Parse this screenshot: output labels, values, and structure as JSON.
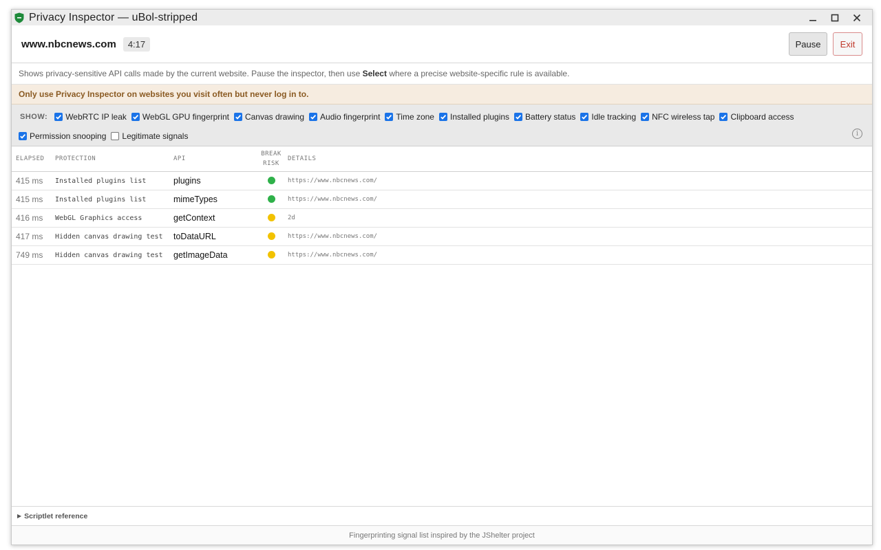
{
  "window": {
    "title": "Privacy Inspector — uBol-stripped"
  },
  "header": {
    "site": "www.nbcnews.com",
    "timer": "4:17",
    "pause_label": "Pause",
    "exit_label": "Exit"
  },
  "description": {
    "before": "Shows privacy-sensitive API calls made by the current website. Pause the inspector, then use ",
    "bold": "Select",
    "after": " where a precise website-specific rule is available."
  },
  "warning": "Only use Privacy Inspector on websites you visit often but never log in to.",
  "filters": {
    "show_label": "SHOW:",
    "items": [
      {
        "label": "WebRTC IP leak",
        "checked": true
      },
      {
        "label": "WebGL GPU fingerprint",
        "checked": true
      },
      {
        "label": "Canvas drawing",
        "checked": true
      },
      {
        "label": "Audio fingerprint",
        "checked": true
      },
      {
        "label": "Time zone",
        "checked": true
      },
      {
        "label": "Installed plugins",
        "checked": true
      },
      {
        "label": "Battery status",
        "checked": true
      },
      {
        "label": "Idle tracking",
        "checked": true
      },
      {
        "label": "NFC wireless tap",
        "checked": true
      },
      {
        "label": "Clipboard access",
        "checked": true
      },
      {
        "label": "Permission snooping",
        "checked": true
      },
      {
        "label": "Legitimate signals",
        "checked": false
      }
    ]
  },
  "table": {
    "headers": {
      "elapsed": "ELAPSED",
      "protection": "PROTECTION",
      "api": "API",
      "risk_line1": "BREAK",
      "risk_line2": "RISK",
      "details": "DETAILS"
    },
    "rows": [
      {
        "elapsed": "415 ms",
        "protection": "Installed plugins list",
        "api": "plugins",
        "risk": "green",
        "details": "https://www.nbcnews.com/"
      },
      {
        "elapsed": "415 ms",
        "protection": "Installed plugins list",
        "api": "mimeTypes",
        "risk": "green",
        "details": "https://www.nbcnews.com/"
      },
      {
        "elapsed": "416 ms",
        "protection": "WebGL Graphics access",
        "api": "getContext",
        "risk": "yellow",
        "details": "2d"
      },
      {
        "elapsed": "417 ms",
        "protection": "Hidden canvas drawing test",
        "api": "toDataURL",
        "risk": "yellow",
        "details": "https://www.nbcnews.com/"
      },
      {
        "elapsed": "749 ms",
        "protection": "Hidden canvas drawing test",
        "api": "getImageData",
        "risk": "yellow",
        "details": "https://www.nbcnews.com/"
      }
    ]
  },
  "risk_colors": {
    "green": "#2fb14a",
    "yellow": "#f2c200"
  },
  "scriptlet_label": "Scriptlet reference",
  "footer": "Fingerprinting signal list inspired by the JShelter project",
  "icons": {
    "app": "shield-icon",
    "minimize": "minimize-icon",
    "maximize": "maximize-icon",
    "close": "close-icon",
    "info": "info-icon"
  }
}
